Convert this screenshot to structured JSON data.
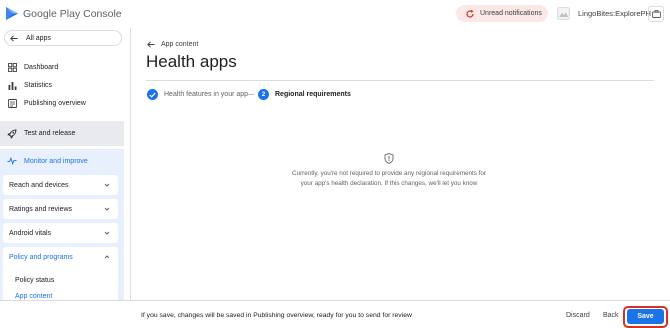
{
  "header": {
    "logo_text": "Google Play Console",
    "notifications_label": "Unread notifications",
    "account_name": "LingoBites:ExplorePH"
  },
  "sidebar": {
    "all_apps": "All apps",
    "items": [
      {
        "label": "Dashboard",
        "icon": "dashboard-icon"
      },
      {
        "label": "Statistics",
        "icon": "bar-chart-icon"
      },
      {
        "label": "Publishing overview",
        "icon": "publishing-icon"
      },
      {
        "label": "Test and release",
        "icon": "rocket-icon"
      },
      {
        "label": "Monitor and improve",
        "icon": "pulse-icon"
      }
    ],
    "sections": [
      {
        "label": "Reach and devices"
      },
      {
        "label": "Ratings and reviews"
      },
      {
        "label": "Android vitals"
      },
      {
        "label": "Policy and programs"
      }
    ],
    "sub_items": [
      {
        "label": "Policy status"
      },
      {
        "label": "App content"
      }
    ]
  },
  "main": {
    "back_link": "App content",
    "title": "Health apps",
    "steps": [
      {
        "label": "Health features in your app",
        "state": "done"
      },
      {
        "number": "2",
        "label": "Regional requirements",
        "state": "current"
      }
    ],
    "info_text": "Currently, you're not required to provide any regional requirements for your app's health declaration. If this changes, we'll let you know"
  },
  "footer": {
    "message": "If you save, changes will be saved in Publishing overview, ready for you to send for review",
    "discard_label": "Discard",
    "back_label": "Back",
    "save_label": "Save"
  },
  "colors": {
    "accent": "#1a73e8",
    "highlight_outline": "#d93025",
    "notification_bg": "#fce8e6",
    "selected_bg": "#e8f0fe"
  }
}
